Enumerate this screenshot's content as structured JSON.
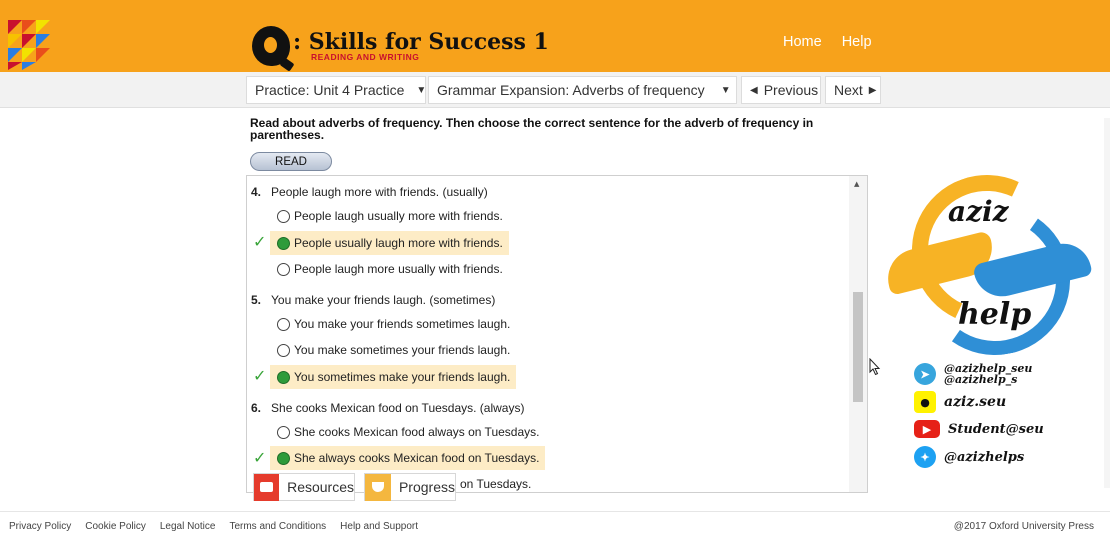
{
  "header": {
    "brand_title": ": Skills for Success 1",
    "brand_subtitle": "READING AND WRITING",
    "nav": [
      {
        "label": "Home"
      },
      {
        "label": "Help"
      }
    ]
  },
  "toolbar": {
    "practice_select": "Practice: Unit 4 Practice",
    "activity_select": "Grammar Expansion: Adverbs of frequency",
    "previous_label": "Previous",
    "next_label": "Next"
  },
  "content": {
    "instructions": "Read about adverbs of frequency. Then choose the correct sentence for the adverb of frequency in parentheses.",
    "read_button": "READ",
    "questions": [
      {
        "number": "4.",
        "prompt": "People laugh more with friends. (usually)",
        "options": [
          {
            "text": "People laugh usually more with friends.",
            "selected": false
          },
          {
            "text": "People usually laugh more with friends.",
            "selected": true
          },
          {
            "text": "People laugh more usually with friends.",
            "selected": false
          }
        ]
      },
      {
        "number": "5.",
        "prompt": "You make your friends laugh. (sometimes)",
        "options": [
          {
            "text": "You make your friends sometimes laugh.",
            "selected": false
          },
          {
            "text": "You make sometimes your friends laugh.",
            "selected": false
          },
          {
            "text": "You sometimes make your friends laugh.",
            "selected": true
          }
        ]
      },
      {
        "number": "6.",
        "prompt": "She cooks Mexican food on Tuesdays. (always)",
        "options": [
          {
            "text": "She cooks Mexican food always on Tuesdays.",
            "selected": false
          },
          {
            "text": "She always cooks Mexican food on Tuesdays.",
            "selected": true
          },
          {
            "text": "She cooks Mexican food alw... on Tuesdays.",
            "partial_visible": "on Tuesdays.",
            "selected": false
          }
        ]
      }
    ],
    "scroll_position": 0.45
  },
  "floating_buttons": {
    "resources_label": "Resources",
    "progress_label": "Progress"
  },
  "footer": {
    "links": [
      "Privacy Policy",
      "Cookie Policy",
      "Legal Notice",
      "Terms and Conditions",
      "Help and Support"
    ],
    "copyright": "@2017 Oxford University Press"
  },
  "watermark": {
    "word_top": "aziz",
    "word_bottom": "help",
    "telegram": [
      "@azizhelp_seu",
      "@azizhelp_s"
    ],
    "snapchat": "aziz.seu",
    "youtube": "Student@seu",
    "twitter": "@azizhelps"
  },
  "colors": {
    "header_orange": "#f7a21b",
    "correct_highlight": "#fdecc6",
    "correct_green": "#2e9b3a",
    "brand_red": "#c8102e"
  }
}
